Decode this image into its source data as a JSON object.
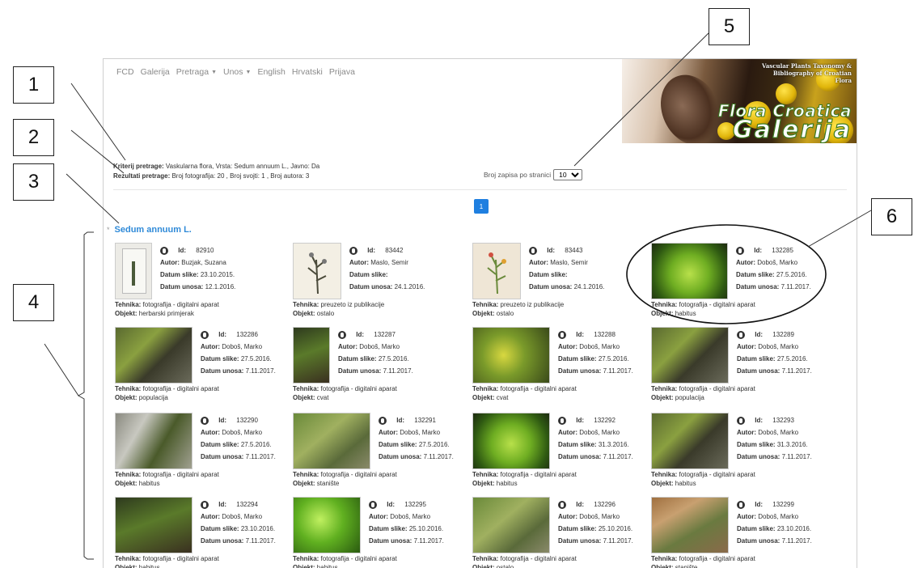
{
  "nav": {
    "items": [
      {
        "label": "FCD",
        "dropdown": false
      },
      {
        "label": "Galerija",
        "dropdown": false
      },
      {
        "label": "Pretraga",
        "dropdown": true
      },
      {
        "label": "Unos",
        "dropdown": true
      },
      {
        "label": "English",
        "dropdown": false
      },
      {
        "label": "Hrvatski",
        "dropdown": false
      },
      {
        "label": "Prijava",
        "dropdown": false
      }
    ]
  },
  "banner": {
    "caption": "Vascular Plants Taxonomy & Bibliography of Croatian Flora",
    "title1": "Flora Croatica",
    "title2": "Galerija"
  },
  "search": {
    "criteria_label": "Kriterij pretrage:",
    "criteria_value": "Vaskularna flora, Vrsta: Sedum annuum L., Javno: Da",
    "results_label": "Rezultati pretrage:",
    "results_value": "Broj fotografija: 20 , Broj svojti: 1 , Broj autora: 3",
    "page_size_label": "Broj zapisa po stranici",
    "page_size_value": "10"
  },
  "pagination": {
    "current": "1"
  },
  "species": {
    "name": "Sedum annuum L.",
    "marker": "*"
  },
  "labels": {
    "id": "Id:",
    "author": "Autor:",
    "date_image": "Datum slike:",
    "date_entry": "Datum unosa:",
    "technique": "Tehnika:",
    "object": "Objekt:"
  },
  "cards": [
    {
      "id": "82910",
      "author": "Buzjak, Suzana",
      "date_image": "23.10.2015.",
      "date_entry": "12.1.2016.",
      "technique": "fotografija - digitalni aparat",
      "object": "herbarski primjerak",
      "thumb": "herbarium"
    },
    {
      "id": "83442",
      "author": "Maslo, Semir",
      "date_image": "",
      "date_entry": "24.1.2016.",
      "technique": "preuzeto iz publikacije",
      "object": "ostalo",
      "thumb": "drawing"
    },
    {
      "id": "83443",
      "author": "Maslo, Semir",
      "date_image": "",
      "date_entry": "24.1.2016.",
      "technique": "preuzeto iz publikacije",
      "object": "ostalo",
      "thumb": "drawing-color"
    },
    {
      "id": "132285",
      "author": "Doboš, Marko",
      "date_image": "27.5.2016.",
      "date_entry": "7.11.2017.",
      "technique": "fotografija - digitalni aparat",
      "object": "habitus",
      "thumb": "green"
    },
    {
      "id": "132286",
      "author": "Doboš, Marko",
      "date_image": "27.5.2016.",
      "date_entry": "7.11.2017.",
      "technique": "fotografija - digitalni aparat",
      "object": "populacija",
      "thumb": "rock"
    },
    {
      "id": "132287",
      "author": "Doboš, Marko",
      "date_image": "27.5.2016.",
      "date_entry": "7.11.2017.",
      "technique": "fotografija - digitalni aparat",
      "object": "cvat",
      "thumb": "dark"
    },
    {
      "id": "132288",
      "author": "Doboš, Marko",
      "date_image": "27.5.2016.",
      "date_entry": "7.11.2017.",
      "technique": "fotografija - digitalni aparat",
      "object": "cvat",
      "thumb": "yellow"
    },
    {
      "id": "132289",
      "author": "Doboš, Marko",
      "date_image": "27.5.2016.",
      "date_entry": "7.11.2017.",
      "technique": "fotografija - digitalni aparat",
      "object": "populacija",
      "thumb": "rock"
    },
    {
      "id": "132290",
      "author": "Doboš, Marko",
      "date_image": "27.5.2016.",
      "date_entry": "7.11.2017.",
      "technique": "fotografija - digitalni aparat",
      "object": "habitus",
      "thumb": "grey"
    },
    {
      "id": "132291",
      "author": "Doboš, Marko",
      "date_image": "27.5.2016.",
      "date_entry": "7.11.2017.",
      "technique": "fotografija - digitalni aparat",
      "object": "stanište",
      "thumb": "grass"
    },
    {
      "id": "132292",
      "author": "Doboš, Marko",
      "date_image": "31.3.2016.",
      "date_entry": "7.11.2017.",
      "technique": "fotografija - digitalni aparat",
      "object": "habitus",
      "thumb": "green"
    },
    {
      "id": "132293",
      "author": "Doboš, Marko",
      "date_image": "31.3.2016.",
      "date_entry": "7.11.2017.",
      "technique": "fotografija - digitalni aparat",
      "object": "habitus",
      "thumb": "rock"
    },
    {
      "id": "132294",
      "author": "Doboš, Marko",
      "date_image": "23.10.2016.",
      "date_entry": "7.11.2017.",
      "technique": "fotografija - digitalni aparat",
      "object": "habitus",
      "thumb": "dark"
    },
    {
      "id": "132295",
      "author": "Doboš, Marko",
      "date_image": "25.10.2016.",
      "date_entry": "7.11.2017.",
      "technique": "fotografija - digitalni aparat",
      "object": "habitus",
      "thumb": "bright"
    },
    {
      "id": "132296",
      "author": "Doboš, Marko",
      "date_image": "25.10.2016.",
      "date_entry": "7.11.2017.",
      "technique": "fotografija - digitalni aparat",
      "object": "ostalo",
      "thumb": "grass"
    },
    {
      "id": "132299",
      "author": "Doboš, Marko",
      "date_image": "23.10.2016.",
      "date_entry": "7.11.2017.",
      "technique": "fotografija - digitalni aparat",
      "object": "stanište",
      "thumb": "autumn"
    }
  ],
  "callouts": [
    "1",
    "2",
    "3",
    "4",
    "5",
    "6"
  ],
  "colors": {
    "accent": "#1f7fe0",
    "species_link": "#2f8ad8"
  }
}
